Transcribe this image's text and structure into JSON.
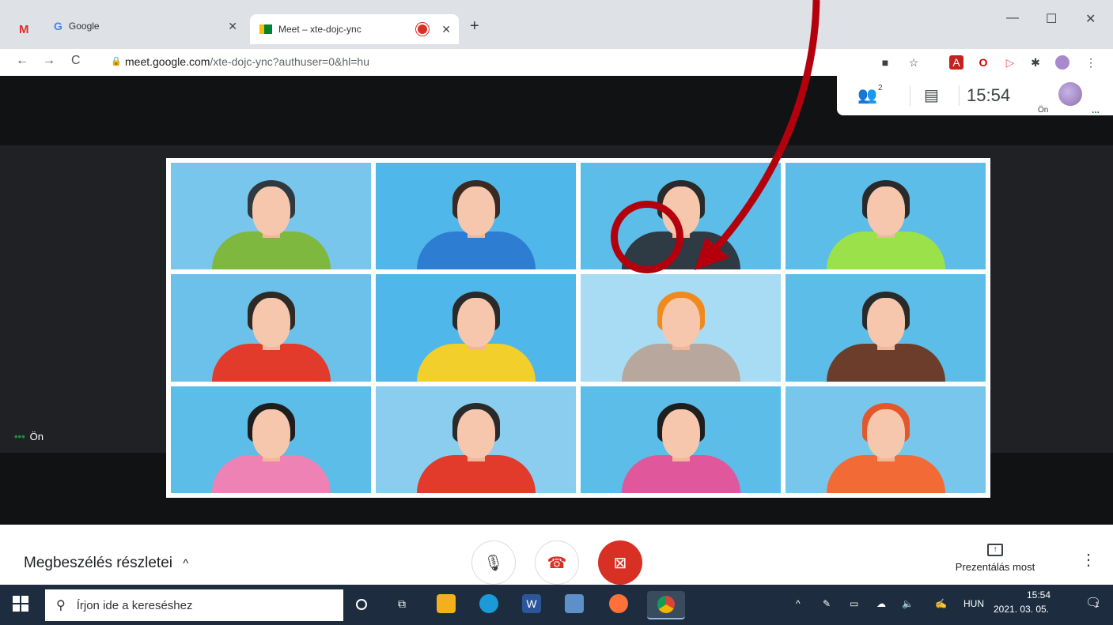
{
  "browser": {
    "tabs": [
      {
        "title": "Google",
        "icon": "google-icon"
      },
      {
        "title": "Meet – xte-dojc-ync",
        "icon": "meet-icon",
        "recording": true
      }
    ],
    "url_host": "meet.google.com",
    "url_path": "/xte-dojc-ync?authuser=0&hl=hu",
    "nav": {
      "back": "←",
      "forward": "→",
      "reload": "C"
    },
    "new_tab": "+",
    "window": {
      "minimize": "—",
      "maximize": "☐",
      "close": "✕"
    },
    "tab_close": "✕"
  },
  "meet": {
    "participant_count": "2",
    "people_icon": "👥",
    "chat_icon": "▤",
    "clock": "15:54",
    "self_small": "Ön",
    "self_label": "Ön",
    "self_dots": "•••",
    "details_label": "Megbeszélés részletei",
    "details_chevron": "^",
    "present_label": "Prezentálás most",
    "present_glyph": "↑",
    "more_glyph": "⋮",
    "mic_glyph": "🎙",
    "hangup_glyph": "☎",
    "cam_glyph": "⊠"
  },
  "taskbar": {
    "search_placeholder": "Írjon ide a kereséshez",
    "search_glyph": "⚲",
    "tray_lang": "HUN",
    "tray_time": "15:54",
    "tray_date": "2021. 03. 05.",
    "notification_count": "1",
    "tray_up": "^"
  },
  "tiles": [
    {
      "bg": "#79c6ec",
      "hair": "#2e3a40",
      "body": "#7fb83e"
    },
    {
      "bg": "#4fb7ea",
      "hair": "#3a2a22",
      "body": "#2d7dd2"
    },
    {
      "bg": "#5bbde8",
      "hair": "#2a2a2a",
      "body": "#2e3a44"
    },
    {
      "bg": "#5bbde8",
      "hair": "#2a2a2a",
      "body": "#9be24a"
    },
    {
      "bg": "#6bc1ea",
      "hair": "#2e2a26",
      "body": "#e23a2b"
    },
    {
      "bg": "#4fb7ea",
      "hair": "#2a2a2a",
      "body": "#f2cf2a"
    },
    {
      "bg": "#a7dcf4",
      "hair": "#f08a1c",
      "body": "#b7a79c"
    },
    {
      "bg": "#5bbde8",
      "hair": "#2a2a2a",
      "body": "#6b3d2a"
    },
    {
      "bg": "#5bbde8",
      "hair": "#1e1e1e",
      "body": "#ee82b4"
    },
    {
      "bg": "#8acdee",
      "hair": "#2a2a2a",
      "body": "#e23a2b"
    },
    {
      "bg": "#5bbde8",
      "hair": "#1e1e1e",
      "body": "#e0589b"
    },
    {
      "bg": "#79c6ec",
      "hair": "#e2572b",
      "body": "#f26a35"
    }
  ],
  "colors": {
    "accent_red": "#d93025",
    "annotation_red": "#b3000c",
    "meet_bg": "#202124"
  }
}
